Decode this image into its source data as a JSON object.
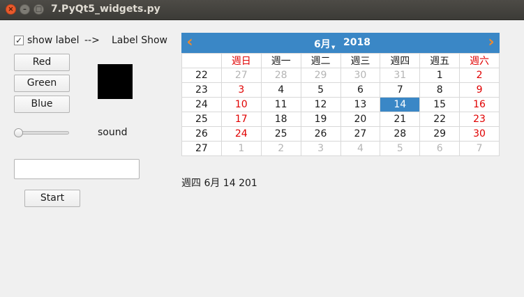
{
  "window": {
    "title": "7.PyQt5_widgets.py"
  },
  "checkbox": {
    "checked": true,
    "mark": "✓",
    "label": "show label"
  },
  "arrow_text": "-->",
  "label_show": "Label Show",
  "buttons": {
    "red": "Red",
    "green": "Green",
    "blue": "Blue",
    "start": "Start"
  },
  "swatch": {
    "color": "#000000"
  },
  "slider": {
    "label": "sound",
    "value": 0
  },
  "textbox": {
    "value": ""
  },
  "calendar": {
    "month": "6月",
    "year": "2018",
    "prev_icon": "chevron-left-icon",
    "next_icon": "chevron-right-icon",
    "weekdays": [
      "週日",
      "週一",
      "週二",
      "週三",
      "週四",
      "週五",
      "週六"
    ],
    "weeks": [
      {
        "week": "22",
        "days": [
          {
            "d": "27",
            "t": "dim"
          },
          {
            "d": "28",
            "t": "dim"
          },
          {
            "d": "29",
            "t": "dim"
          },
          {
            "d": "30",
            "t": "dim"
          },
          {
            "d": "31",
            "t": "dim"
          },
          {
            "d": "1",
            "t": "n"
          },
          {
            "d": "2",
            "t": "red"
          }
        ]
      },
      {
        "week": "23",
        "days": [
          {
            "d": "3",
            "t": "red"
          },
          {
            "d": "4",
            "t": "n"
          },
          {
            "d": "5",
            "t": "n"
          },
          {
            "d": "6",
            "t": "n"
          },
          {
            "d": "7",
            "t": "n"
          },
          {
            "d": "8",
            "t": "n"
          },
          {
            "d": "9",
            "t": "red"
          }
        ]
      },
      {
        "week": "24",
        "days": [
          {
            "d": "10",
            "t": "red"
          },
          {
            "d": "11",
            "t": "n"
          },
          {
            "d": "12",
            "t": "n"
          },
          {
            "d": "13",
            "t": "n"
          },
          {
            "d": "14",
            "t": "sel"
          },
          {
            "d": "15",
            "t": "n"
          },
          {
            "d": "16",
            "t": "red"
          }
        ]
      },
      {
        "week": "25",
        "days": [
          {
            "d": "17",
            "t": "red"
          },
          {
            "d": "18",
            "t": "n"
          },
          {
            "d": "19",
            "t": "n"
          },
          {
            "d": "20",
            "t": "n"
          },
          {
            "d": "21",
            "t": "n"
          },
          {
            "d": "22",
            "t": "n"
          },
          {
            "d": "23",
            "t": "red"
          }
        ]
      },
      {
        "week": "26",
        "days": [
          {
            "d": "24",
            "t": "red"
          },
          {
            "d": "25",
            "t": "n"
          },
          {
            "d": "26",
            "t": "n"
          },
          {
            "d": "27",
            "t": "n"
          },
          {
            "d": "28",
            "t": "n"
          },
          {
            "d": "29",
            "t": "n"
          },
          {
            "d": "30",
            "t": "red"
          }
        ]
      },
      {
        "week": "27",
        "days": [
          {
            "d": "1",
            "t": "dim"
          },
          {
            "d": "2",
            "t": "dim"
          },
          {
            "d": "3",
            "t": "dim"
          },
          {
            "d": "4",
            "t": "dim"
          },
          {
            "d": "5",
            "t": "dim"
          },
          {
            "d": "6",
            "t": "dim"
          },
          {
            "d": "7",
            "t": "dim"
          }
        ]
      }
    ]
  },
  "selected_date_text": "週四 6月 14 201",
  "colors": {
    "accent": "#3a87c6",
    "weekend": "#e00000",
    "nav_arrow": "#f08a2c"
  }
}
